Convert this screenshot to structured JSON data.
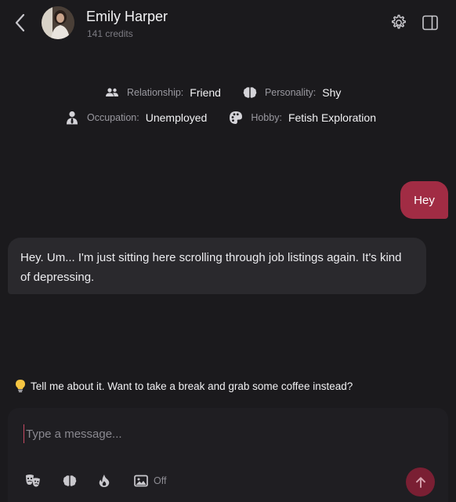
{
  "header": {
    "name": "Emily Harper",
    "credits": "141 credits"
  },
  "traits": {
    "relationship": {
      "label": "Relationship:",
      "value": "Friend"
    },
    "personality": {
      "label": "Personality:",
      "value": "Shy"
    },
    "occupation": {
      "label": "Occupation:",
      "value": "Unemployed"
    },
    "hobby": {
      "label": "Hobby:",
      "value": "Fetish Exploration"
    }
  },
  "messages": {
    "outgoing": "Hey",
    "incoming": "Hey. Um... I'm just sitting here scrolling through job listings again. It's kind of depressing."
  },
  "suggestion": "Tell me about it. Want to take a break and grab some coffee instead?",
  "composer": {
    "placeholder": "Type a message...",
    "image_toggle": "Off"
  },
  "colors": {
    "background": "#1b1a1d",
    "accent": "#a12c44",
    "send_button": "#7a1f33",
    "bubble_incoming": "#2a292d"
  }
}
